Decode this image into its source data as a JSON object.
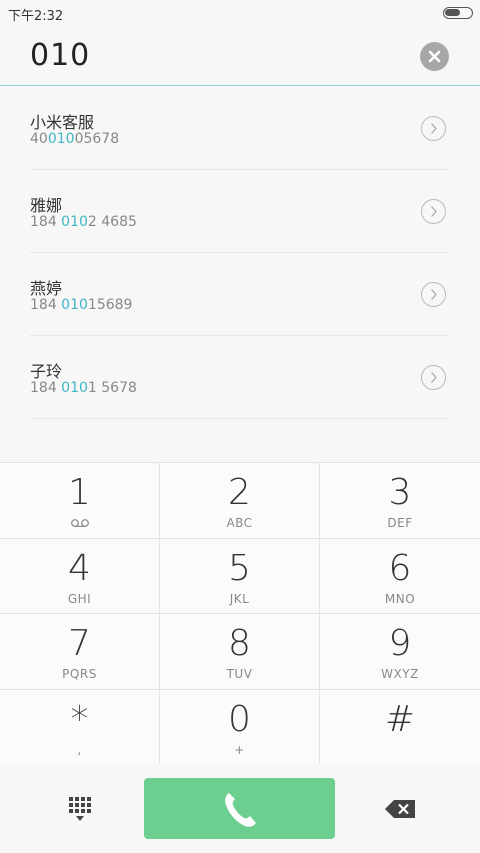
{
  "status_bar": {
    "time": "下午2:32",
    "battery_level": 0.6
  },
  "dial": {
    "number": "010"
  },
  "contacts": [
    {
      "name": "小米客服",
      "number_pre": "40",
      "number_match": "010",
      "number_post": "05678"
    },
    {
      "name": "雅娜",
      "number_pre": "184 ",
      "number_match": "010",
      "number_post": "2 4685"
    },
    {
      "name": "燕婷",
      "number_pre": "184 ",
      "number_match": "010",
      "number_post": "15689"
    },
    {
      "name": "子玲",
      "number_pre": "184 ",
      "number_match": "010",
      "number_post": "1 5678"
    }
  ],
  "keypad": {
    "keys": [
      {
        "digit": "1",
        "letters": "",
        "sub_icon": "voicemail-icon"
      },
      {
        "digit": "2",
        "letters": "ABC"
      },
      {
        "digit": "3",
        "letters": "DEF"
      },
      {
        "digit": "4",
        "letters": "GHI"
      },
      {
        "digit": "5",
        "letters": "JKL"
      },
      {
        "digit": "6",
        "letters": "MNO"
      },
      {
        "digit": "7",
        "letters": "PQRS"
      },
      {
        "digit": "8",
        "letters": "TUV"
      },
      {
        "digit": "9",
        "letters": "WXYZ"
      },
      {
        "digit": "*",
        "letters": ","
      },
      {
        "digit": "0",
        "letters": "+"
      },
      {
        "digit": "#",
        "letters": ""
      }
    ]
  },
  "bottom_bar": {
    "dialpad_icon": "dialpad-icon",
    "call_icon": "phone-icon",
    "backspace_icon": "backspace-icon"
  },
  "colors": {
    "accent": "#3fb6c5",
    "call_button": "#6ccf8f",
    "divider": "#8fd5dc"
  }
}
